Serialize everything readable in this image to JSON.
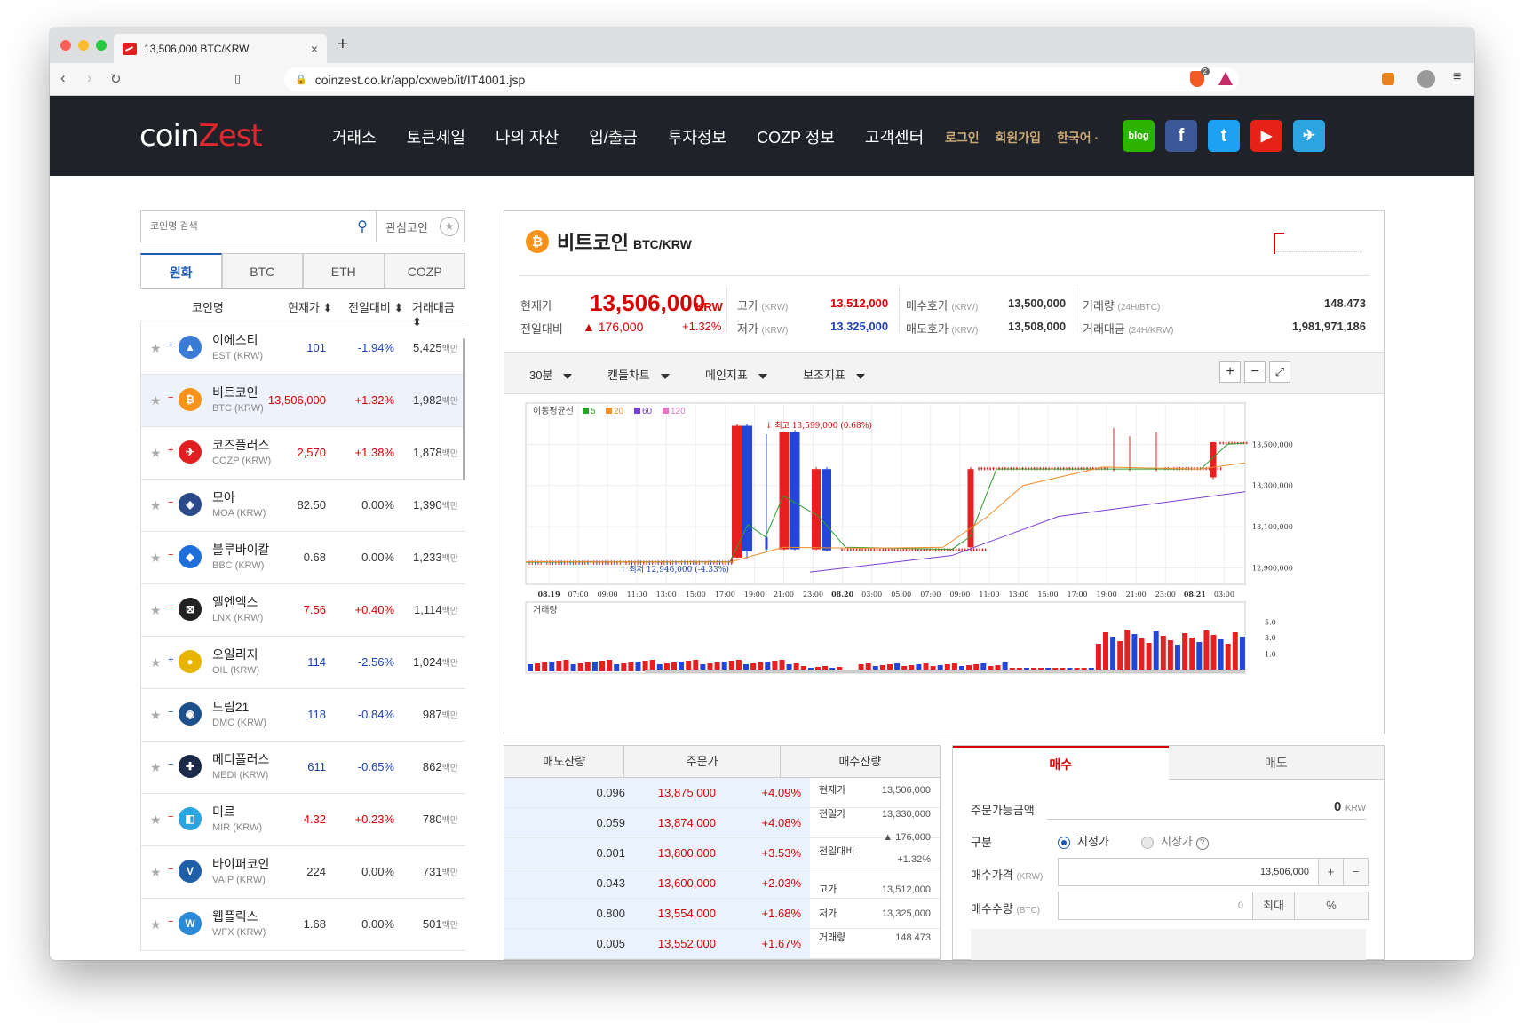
{
  "browser": {
    "tab_title": "13,506,000 BTC/KRW",
    "url": "coinzest.co.kr/app/cxweb/it/IT4001.jsp",
    "brave_badge": "2"
  },
  "site": {
    "logo_a": "coin",
    "logo_b": "Zest",
    "nav": [
      "거래소",
      "토큰세일",
      "나의 자산",
      "입/출금",
      "투자정보",
      "COZP 정보",
      "고객센터"
    ],
    "login": "로그인",
    "signup": "회원가입",
    "lang": "한국어 ·",
    "social": [
      "blog",
      "f",
      "t",
      "▶",
      "✈"
    ]
  },
  "sidebar": {
    "search_placeholder": "코인명 검색",
    "fav_label": "관심코인",
    "tabs": [
      "원화",
      "BTC",
      "ETH",
      "COZP"
    ],
    "headers": [
      "코인명",
      "현재가 ⬍",
      "전일대비 ⬍",
      "거래대금 ⬍"
    ],
    "coins": [
      {
        "name": "이에스티",
        "sym": "EST (KRW)",
        "price": "101",
        "chg": "-1.94%",
        "vol": "5,425",
        "mk": "+",
        "dir": "down",
        "color": "#3a7bd5",
        "glyph": "▲"
      },
      {
        "name": "비트코인",
        "sym": "BTC (KRW)",
        "price": "13,506,000",
        "chg": "+1.32%",
        "vol": "1,982",
        "mk": "−",
        "dir": "up",
        "color": "#f7931a",
        "glyph": "₿"
      },
      {
        "name": "코즈플러스",
        "sym": "COZP (KRW)",
        "price": "2,570",
        "chg": "+1.38%",
        "vol": "1,878",
        "mk": "+",
        "dir": "up",
        "color": "#e02020",
        "glyph": "✈"
      },
      {
        "name": "모아",
        "sym": "MOA (KRW)",
        "price": "82.50",
        "chg": "0.00%",
        "vol": "1,390",
        "mk": "−",
        "dir": "flat",
        "color": "#2c4a8a",
        "glyph": "◈"
      },
      {
        "name": "블루바이칼",
        "sym": "BBC (KRW)",
        "price": "0.68",
        "chg": "0.00%",
        "vol": "1,233",
        "mk": "−",
        "dir": "flat",
        "color": "#1e6fd9",
        "glyph": "◆"
      },
      {
        "name": "엘엔엑스",
        "sym": "LNX (KRW)",
        "price": "7.56",
        "chg": "+0.40%",
        "vol": "1,114",
        "mk": "−",
        "dir": "up",
        "color": "#222",
        "glyph": "⊠"
      },
      {
        "name": "오일리지",
        "sym": "OIL (KRW)",
        "price": "114",
        "chg": "-2.56%",
        "vol": "1,024",
        "mk": "+",
        "dir": "down",
        "color": "#e8b400",
        "glyph": "●"
      },
      {
        "name": "드림21",
        "sym": "DMC (KRW)",
        "price": "118",
        "chg": "-0.84%",
        "vol": "987",
        "mk": "−",
        "dir": "down",
        "color": "#1d4f8a",
        "glyph": "◉"
      },
      {
        "name": "메디플러스",
        "sym": "MEDI (KRW)",
        "price": "611",
        "chg": "-0.65%",
        "vol": "862",
        "mk": "−",
        "dir": "down",
        "color": "#1c2a4a",
        "glyph": "✚"
      },
      {
        "name": "미르",
        "sym": "MIR (KRW)",
        "price": "4.32",
        "chg": "+0.23%",
        "vol": "780",
        "mk": "−",
        "dir": "up",
        "color": "#2aa4e0",
        "glyph": "◧"
      },
      {
        "name": "바이퍼코인",
        "sym": "VAIP (KRW)",
        "price": "224",
        "chg": "0.00%",
        "vol": "731",
        "mk": "−",
        "dir": "flat",
        "color": "#1e5fa8",
        "glyph": "V"
      },
      {
        "name": "웹플릭스",
        "sym": "WFX (KRW)",
        "price": "1.68",
        "chg": "0.00%",
        "vol": "501",
        "mk": "−",
        "dir": "flat",
        "color": "#2a8ad8",
        "glyph": "W"
      }
    ],
    "unit": "백만"
  },
  "ticker": {
    "name": "비트코인",
    "pair": "BTC/KRW",
    "cur_label": "현재가",
    "cur": "13,506,000",
    "cur_unit": "KRW",
    "prev_label": "전일대비",
    "prev": "▲ 176,000",
    "prev_pct": "+1.32%",
    "high_label": "고가",
    "high": "13,512,000",
    "low_label": "저가",
    "low": "13,325,000",
    "krw": "(KRW)",
    "bid_label": "매수호가",
    "bid": "13,500,000",
    "ask_label": "매도호가",
    "ask": "13,508,000",
    "volq_label": "거래량",
    "volq_unit": "(24H/BTC)",
    "volq": "148.473",
    "vola_label": "거래대금",
    "vola_unit": "(24H/KRW)",
    "vola": "1,981,971,186"
  },
  "toolbar": {
    "period": "30분",
    "ctype": "캔들차트",
    "main": "메인지표",
    "aux": "보조지표",
    "plus": "+",
    "minus": "−",
    "full": "⤢"
  },
  "chart_data": {
    "type": "candlestick",
    "legend_title": "이동평균선",
    "ma": [
      "5",
      "20",
      "60",
      "120"
    ],
    "ma_colors": [
      "#2ca02c",
      "#f28e2b",
      "#7b3fd4",
      "#e377c2"
    ],
    "max_label": "↓ 최고 13,599,000 (0.68%)",
    "min_label": "↑ 최저 12,946,000 (-4.33%)",
    "y_ticks": [
      "13,500,000",
      "13,300,000",
      "13,100,000",
      "12,900,000"
    ],
    "x_ticks": [
      "08.19",
      "07:00",
      "09:00",
      "11:00",
      "13:00",
      "15:00",
      "17:00",
      "19:00",
      "21:00",
      "23:00",
      "08.20",
      "03:00",
      "05:00",
      "07:00",
      "09:00",
      "11:00",
      "13:00",
      "15:00",
      "17:00",
      "19:00",
      "21:00",
      "23:00",
      "08.21",
      "03:00"
    ],
    "volume_label": "거래량",
    "volume_ticks": [
      "5.0",
      "3.0",
      "1.0"
    ]
  },
  "orderbook": {
    "headers": [
      "매도잔량",
      "주문가",
      "매수잔량"
    ],
    "rows": [
      {
        "a": "0.096",
        "p": "13,875,000",
        "c": "+4.09%"
      },
      {
        "a": "0.059",
        "p": "13,874,000",
        "c": "+4.08%"
      },
      {
        "a": "0.001",
        "p": "13,800,000",
        "c": "+3.53%"
      },
      {
        "a": "0.043",
        "p": "13,600,000",
        "c": "+2.03%"
      },
      {
        "a": "0.800",
        "p": "13,554,000",
        "c": "+1.68%"
      },
      {
        "a": "0.005",
        "p": "13,552,000",
        "c": "+1.67%"
      }
    ],
    "side": {
      "cur_k": "현재가",
      "cur_v": "13,506,000",
      "prev_k": "전일가",
      "prev_v": "13,330,000",
      "chg_k": "전일대비",
      "chg_v1": "▲ 176,000",
      "chg_v2": "+1.32%",
      "high_k": "고가",
      "high_v": "13,512,000",
      "low_k": "저가",
      "low_v": "13,325,000",
      "vol_k": "거래량",
      "vol_v": "148.473"
    }
  },
  "order": {
    "tab_buy": "매수",
    "tab_sell": "매도",
    "avail_label": "주문가능금액",
    "avail_val": "0",
    "avail_unit": "KRW",
    "type_label": "구분",
    "limit": "지정가",
    "market": "시장가",
    "price_label": "매수가격",
    "price_unit": "(KRW)",
    "price_val": "13,506,000",
    "qty_label": "매수수량",
    "qty_unit": "(BTC)",
    "qty_val": "0",
    "max": "최대",
    "pct": "%",
    "plus": "+",
    "minus": "−"
  }
}
